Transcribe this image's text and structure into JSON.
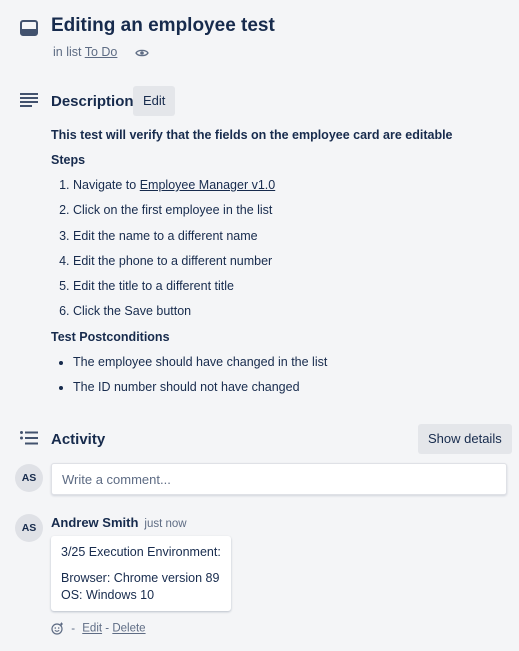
{
  "card": {
    "title": "Editing an employee test",
    "in_list_prefix": "in list",
    "list_name": "To Do"
  },
  "description": {
    "title": "Description",
    "edit_label": "Edit",
    "lead": "This test will verify that the fields on the employee card are editable",
    "steps_heading": "Steps",
    "steps": {
      "s1_prefix": "Navigate to",
      "s1_link": "Employee Manager v1.0",
      "s2": "Click on the first employee in the list",
      "s3": "Edit the name to a different name",
      "s4": "Edit the phone to a different number",
      "s5": "Edit the title to a different title",
      "s6": "Click the Save button"
    },
    "post_heading": "Test Postconditions",
    "post": [
      "The employee should have changed in the list",
      "The ID number should not have changed"
    ]
  },
  "activity": {
    "title": "Activity",
    "show_details_label": "Show details",
    "user_initials": "AS",
    "comment_placeholder": "Write a comment..."
  },
  "comment": {
    "initials": "AS",
    "author": "Andrew Smith",
    "time": "just now",
    "line1": "3/25 Execution Environment:",
    "line2": "Browser: Chrome version 89",
    "line3": "OS: Windows 10",
    "separator": "-",
    "edit_label": "Edit",
    "delete_label": "Delete"
  },
  "colors": {
    "background": "#f4f5f7",
    "text": "#172b4d",
    "muted": "#5e6c84",
    "button": "#e4e6ea"
  }
}
